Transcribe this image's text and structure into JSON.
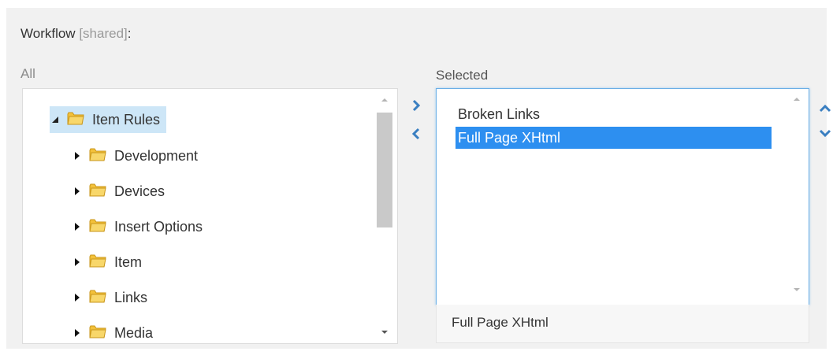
{
  "field": {
    "label": "Workflow",
    "shared": "[shared]",
    "colon": ":"
  },
  "all_label": "All",
  "selected_label": "Selected",
  "tree": {
    "root": {
      "label": "Item Rules",
      "icon": "folder-icon",
      "expanded": true
    },
    "children": [
      {
        "label": "Development",
        "icon": "folder-icon"
      },
      {
        "label": "Devices",
        "icon": "folder-icon"
      },
      {
        "label": "Insert Options",
        "icon": "folder-icon"
      },
      {
        "label": "Item",
        "icon": "folder-icon"
      },
      {
        "label": "Links",
        "icon": "folder-icon"
      },
      {
        "label": "Media",
        "icon": "folder-icon"
      }
    ]
  },
  "selected": {
    "items": [
      {
        "label": "Broken Links",
        "active": false
      },
      {
        "label": "Full Page XHtml",
        "active": true
      }
    ],
    "status": "Full Page XHtml"
  },
  "colors": {
    "accent": "#2d8ff0",
    "tree_highlight": "#cde6f7",
    "arrow_blue": "#3a7fc1",
    "folder_yellow": "#f3c13a"
  }
}
